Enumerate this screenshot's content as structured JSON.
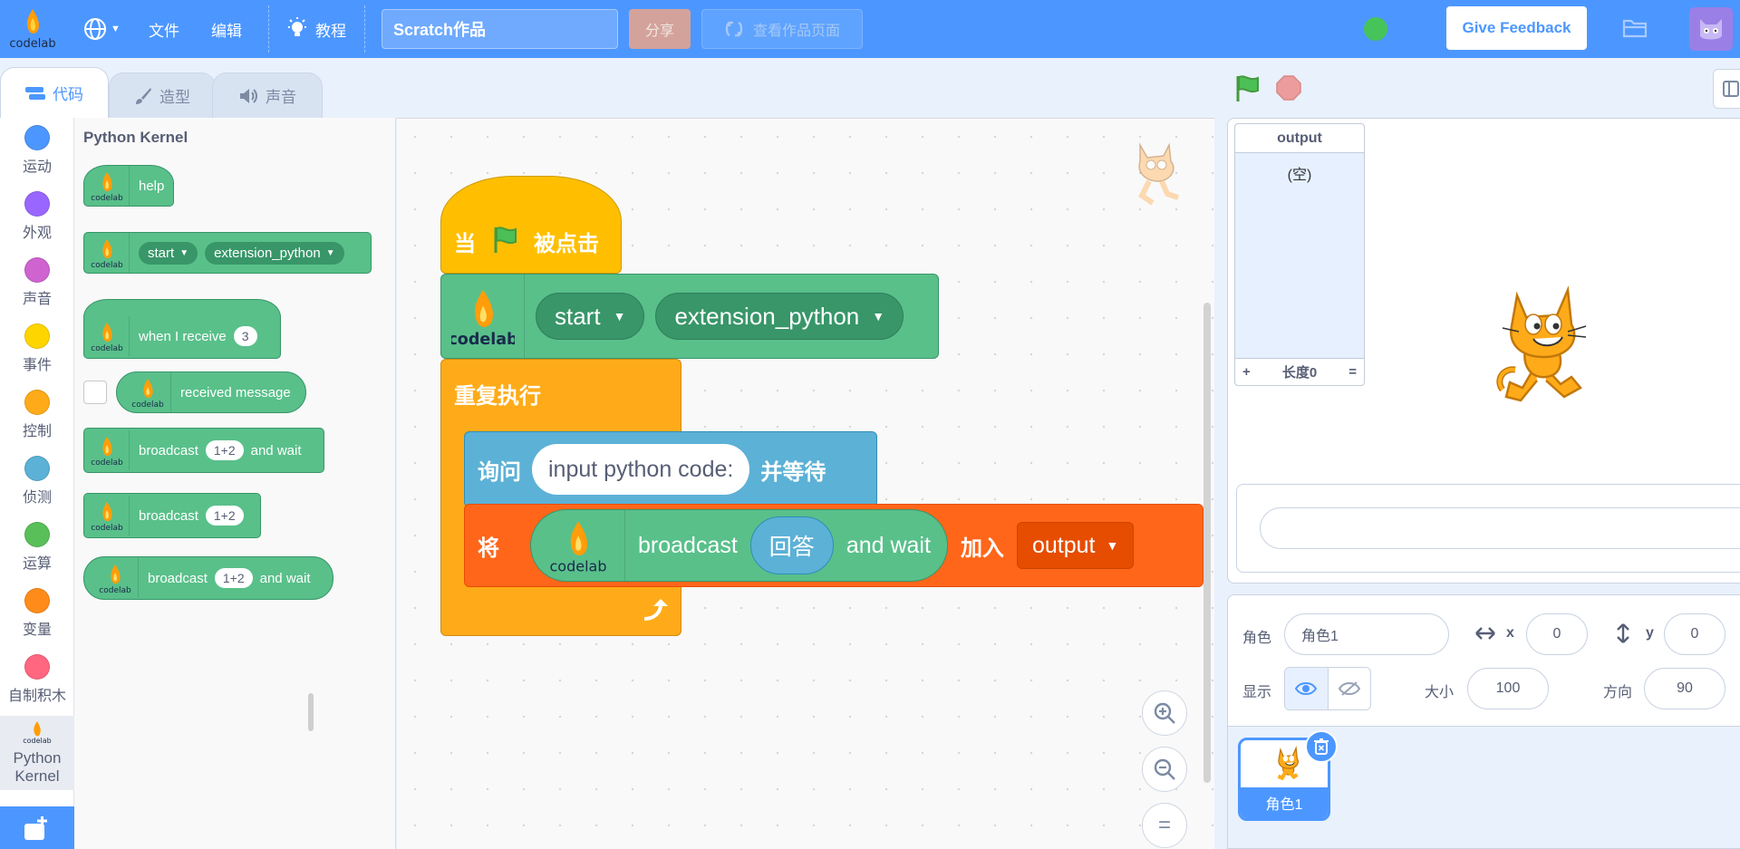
{
  "menubar": {
    "logo_text": "codelab",
    "file": "文件",
    "edit": "编辑",
    "tutorials": "教程",
    "project_title": "Scratch作品",
    "share": "分享",
    "see_project_page": "查看作品页面",
    "feedback": "Give Feedback"
  },
  "tabs": {
    "code": "代码",
    "costumes": "造型",
    "sounds": "声音"
  },
  "categories": [
    {
      "label": "运动",
      "color": "#4c97ff"
    },
    {
      "label": "外观",
      "color": "#9966ff"
    },
    {
      "label": "声音",
      "color": "#cf63cf"
    },
    {
      "label": "事件",
      "color": "#ffd500"
    },
    {
      "label": "控制",
      "color": "#ffab19"
    },
    {
      "label": "侦测",
      "color": "#5cb1d6"
    },
    {
      "label": "运算",
      "color": "#59c059"
    },
    {
      "label": "变量",
      "color": "#ff8c1a"
    },
    {
      "label": "自制积木",
      "color": "#ff6680"
    }
  ],
  "python_category": {
    "line1": "Python",
    "line2": "Kernel"
  },
  "palette": {
    "title": "Python Kernel",
    "help": "help",
    "start": "start",
    "ext": "extension_python",
    "when_receive": "when I receive",
    "when_receive_val": "3",
    "received_message": "received message",
    "broadcast": "broadcast",
    "broadcast_val": "1+2",
    "and_wait": "and wait"
  },
  "script": {
    "when": "当",
    "clicked": "被点击",
    "start": "start",
    "ext": "extension_python",
    "forever": "重复执行",
    "ask": "询问",
    "ask_value": "input python code:",
    "and_wait_cn": "并等待",
    "add": "将",
    "broadcast": "broadcast",
    "answer": "回答",
    "and_wait": "and wait",
    "add_to": "加入",
    "list": "output"
  },
  "zoom": {
    "in": "+",
    "out": "−",
    "reset": "="
  },
  "stage": {
    "list_title": "output",
    "list_empty": "(空)",
    "list_add": "+",
    "list_length": "长度0",
    "list_resize": "="
  },
  "sprite_info": {
    "sprite_label": "角色",
    "sprite_name": "角色1",
    "x_label": "x",
    "x": "0",
    "y_label": "y",
    "y": "0",
    "show_label": "显示",
    "size_label": "大小",
    "size": "100",
    "direction_label": "方向",
    "direction": "90"
  },
  "sprites": [
    {
      "name": "角色1"
    }
  ]
}
